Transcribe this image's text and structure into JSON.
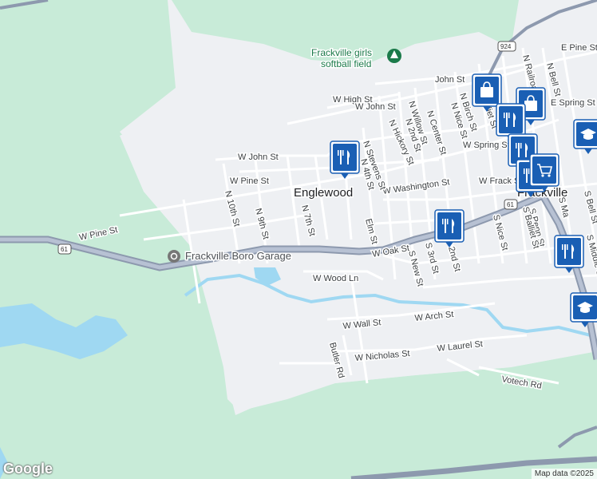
{
  "map": {
    "labels": {
      "town_englewood": "Englewood",
      "town_frackville": "Frackville",
      "poi_softball": "Frackville girls softball field",
      "poi_softball_line1": "Frackville girls",
      "poi_softball_line2": "softball field",
      "poi_garage": "Frackville Boro Garage"
    },
    "streets": {
      "w_high": "W High St",
      "w_john_top": "W John St",
      "w_john_left": "W John St",
      "john": "John St",
      "w_pine_mid": "W Pine St",
      "w_pine_left": "W Pine St",
      "e_pine": "E Pine St",
      "w_washington": "W Washington St",
      "w_spring": "W Spring St",
      "e_spring": "E Spring St",
      "w_frack": "W Frack S",
      "w_oak": "W Oak St",
      "w_wood": "W Wood Ln",
      "w_wall": "W Wall St",
      "w_arch": "W Arch St",
      "w_nicholas": "W Nicholas St",
      "w_laurel": "W Laurel St",
      "votech": "Votech Rd",
      "butler": "Butler Rd",
      "n10": "N 10th St",
      "n9": "N 9th St",
      "n7": "N 7th St",
      "n4": "N 4th St",
      "n_stevens": "N Stevens St",
      "n_hickory": "N Hickory St",
      "n_2nd": "N 2nd St",
      "n_willow": "N Willow St",
      "n_center": "N Center St",
      "n_nice": "N Nice St",
      "n_birch": "N Birch St",
      "n_balliet": "N Balliet St",
      "n_railroad": "N Railroad St",
      "n_bell": "N Bell St",
      "elm": "Elm St",
      "s_new": "S New St",
      "s_3rd": "S 3rd St",
      "s_2nd": "2nd St",
      "s_nice": "S Nice St",
      "s_penn": "S Penn St",
      "s_balliet": "S Balliet St",
      "s_ma": "S Ma",
      "s_bell": "S Bell St",
      "s_middle": "S Middle St"
    },
    "shields": {
      "route61_left": "61",
      "route61_right": "61",
      "route924": "924"
    },
    "markers": [
      {
        "type": "shopping-bag",
        "label": "shopping"
      },
      {
        "type": "shopping-bag",
        "label": "shopping"
      },
      {
        "type": "restaurant",
        "label": "restaurant"
      },
      {
        "type": "restaurant",
        "label": "restaurant"
      },
      {
        "type": "restaurant",
        "label": "restaurant"
      },
      {
        "type": "restaurant",
        "label": "restaurant"
      },
      {
        "type": "restaurant",
        "label": "restaurant"
      },
      {
        "type": "restaurant",
        "label": "restaurant"
      },
      {
        "type": "shopping-cart",
        "label": "grocery"
      },
      {
        "type": "school",
        "label": "school"
      },
      {
        "type": "school",
        "label": "school"
      }
    ],
    "colors": {
      "land": "#eef0f3",
      "park": "#c8ebd8",
      "water": "#9fd8f2",
      "road": "#ffffff",
      "highway": "#8d99ae",
      "marker": "#1a5fb4"
    }
  },
  "footer": {
    "logo": "Google",
    "attribution": "Map data ©2025"
  }
}
